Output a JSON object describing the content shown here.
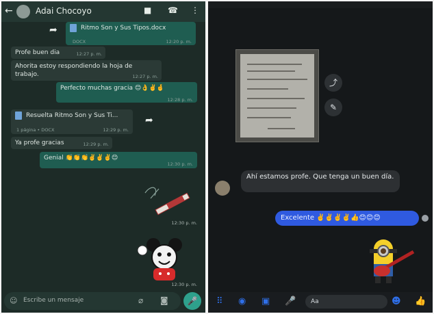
{
  "whatsapp": {
    "contact_name": "Adai Chocoyo",
    "messages": {
      "doc1_name": "Ritmo Son y Sus Tipos.docx",
      "doc1_type": "DOCX",
      "doc1_time": "12:20 p. m.",
      "m1_text": "Profe buen dia",
      "m1_time": "12:27 p. m.",
      "m2_text": "Ahorita estoy respondiendo la hoja de trabajo.",
      "m2_time": "12:27 p. m.",
      "m3_text": "Perfecto muchas gracia",
      "m3_emojis": "😊👌✌️🤞",
      "m3_time": "12:28 p. m.",
      "doc2_name": "Resuelta Ritmo Son y Sus Ti...",
      "doc2_meta": "1 página • DOCX",
      "doc2_time": "12:29 p. m.",
      "m4_text": "Ya profe gracias",
      "m4_time": "12:29 p. m.",
      "m5_text": "Genial",
      "m5_emojis": "👏👏👏✌️✌️✌️😊",
      "m5_time": "12:30 p. m.",
      "sticker1_time": "12:30 p. m.",
      "sticker2_time": "12:30 p. m."
    },
    "input_placeholder": "Escribe un mensaje"
  },
  "messenger": {
    "in_text": "Ahí estamos profe. Que tenga un buen día.",
    "out_text": "Excelente",
    "out_emojis": "✌️✌️✌️✌️👍😊😊😊",
    "input_placeholder": "Aa"
  }
}
